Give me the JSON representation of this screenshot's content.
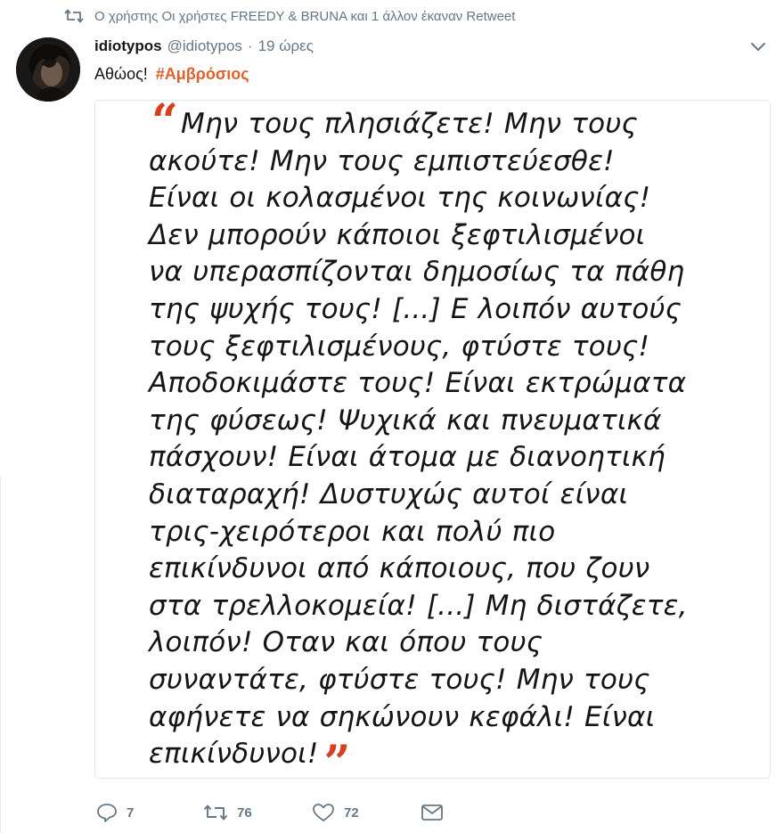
{
  "retweet_context": {
    "icon": "retweet-icon",
    "text": "Ο χρήστης Οι χρήστες FREEDY & BRUNA και 1 άλλον έκαναν Retweet"
  },
  "tweet": {
    "fullname": "idiotypos",
    "handle": "@idiotypos",
    "separator": "·",
    "time": "19 ώρες",
    "text": "Αθώος!",
    "hashtag": "#Αμβρόσιος",
    "menu_icon": "chevron-down-icon"
  },
  "media": {
    "open_quote": "“",
    "close_quote": "”",
    "lines": [
      "Μην τους πλησιάζετε! Μην τους",
      "ακούτε! Μην τους εμπιστεύεσθε!",
      "Είναι οι κολασμένοι της κοινωνίας!",
      "Δεν μπορούν κάποιοι ξεφτιλισμένοι",
      "να υπερασπίζονται δημοσίως τα πάθη",
      "της ψυχής τους! [...] Ε λοιπόν αυτούς",
      "τους ξεφτιλισμένους, φτύστε τους!",
      "Αποδοκιμάστε τους! Είναι εκτρώματα",
      "της φύσεως! Ψυχικά και πνευματικά",
      "πάσχουν! Είναι άτομα με διανοητική",
      "διαταραχή! Δυστυχώς αυτοί είναι",
      "τρις-χειρότεροι και πολύ πιο",
      "επικίνδυνοι από κάποιους, που ζουν",
      "στα τρελλοκομεία! [...] Μη διστάζετε,",
      "λοιπόν! Οταν και όπου τους",
      "συναντάτε, φτύστε τους! Μην τους",
      "αφήνετε να σηκώνουν κεφάλι! Είναι",
      "επικίνδυνοι!"
    ],
    "colors": {
      "quote_mark": "#d5401f",
      "text": "#151515"
    }
  },
  "actions": {
    "reply_count": "7",
    "retweet_count": "76",
    "like_count": "72",
    "icons": [
      "reply-icon",
      "retweet-icon",
      "like-icon",
      "message-icon"
    ]
  },
  "colors": {
    "hashtag": "#e0602e",
    "muted": "#657786",
    "border": "#e1e8ed"
  }
}
